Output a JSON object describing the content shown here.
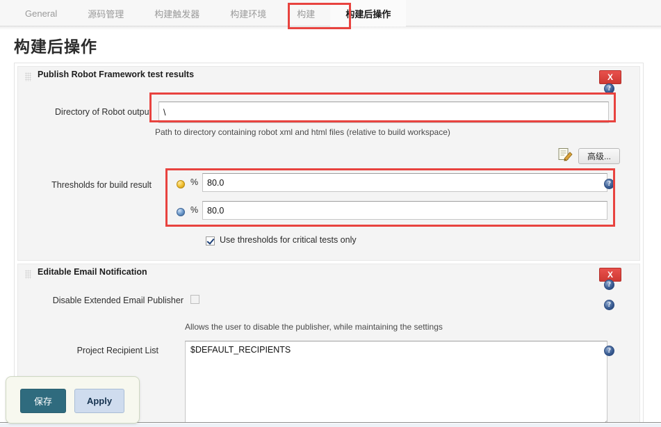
{
  "tabs": [
    {
      "label": "General",
      "active": false
    },
    {
      "label": "源码管理",
      "active": false
    },
    {
      "label": "构建触发器",
      "active": false
    },
    {
      "label": "构建环境",
      "active": false
    },
    {
      "label": "构建",
      "active": false
    },
    {
      "label": "构建后操作",
      "active": true
    }
  ],
  "page": {
    "title": "构建后操作"
  },
  "colors": {
    "highlight_red": "#e8433f",
    "save_button_bg": "#2f6b7e",
    "apply_button_bg": "#cfdcee",
    "close_button_bg": "#cf3933"
  },
  "blocks": [
    {
      "title": "Publish Robot Framework test results",
      "close_label": "X",
      "help_label": "?",
      "fields": {
        "directory_label": "Directory of Robot output",
        "directory_value": "\\",
        "directory_help": "Path to directory containing robot xml and html files (relative to build workspace)",
        "advanced_button": "高级...",
        "thresholds_label": "Thresholds for build result",
        "threshold_unstable_icon": "yellow-ball-icon",
        "threshold_unstable_percent": "%",
        "threshold_unstable_value": "80.0",
        "threshold_failed_icon": "blue-ball-icon",
        "threshold_failed_percent": "%",
        "threshold_failed_value": "80.0",
        "critical_checkbox_label": "Use thresholds for critical tests only",
        "critical_checkbox_checked": true
      }
    },
    {
      "title": "Editable Email Notification",
      "close_label": "X",
      "help_label": "?",
      "fields": {
        "disable_label": "Disable Extended Email Publisher",
        "disable_checked": false,
        "disable_help": "Allows the user to disable the publisher, while maintaining the settings",
        "recipient_label": "Project Recipient List",
        "recipient_value": "$DEFAULT_RECIPIENTS"
      }
    }
  ],
  "savebar": {
    "save_label": "保存",
    "apply_label": "Apply"
  }
}
